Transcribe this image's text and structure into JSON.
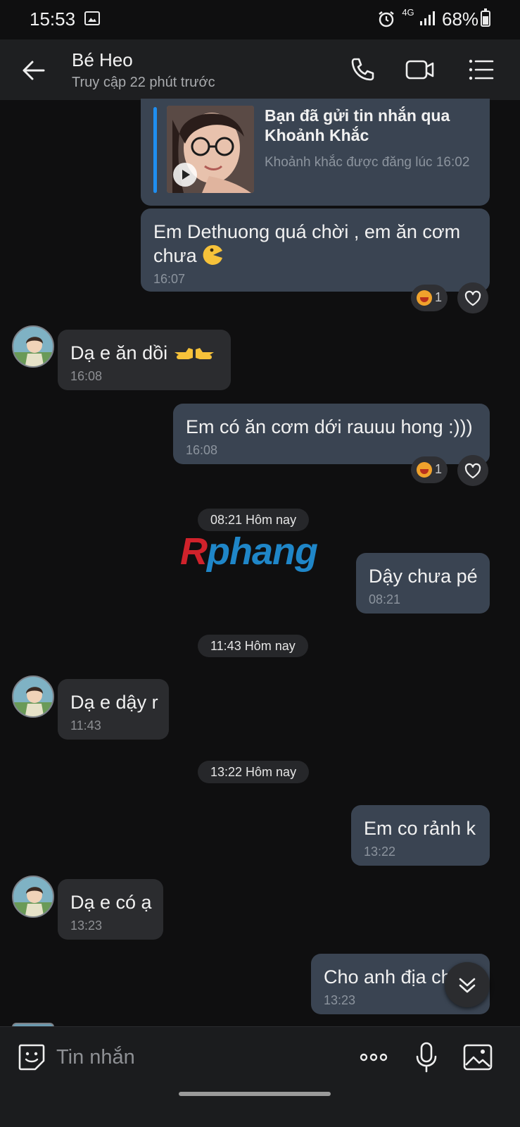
{
  "status_bar": {
    "time": "15:53",
    "network": "4G",
    "battery": "68%",
    "icons": [
      "gallery-icon",
      "alarm-icon",
      "signal-icon",
      "battery-icon"
    ]
  },
  "header": {
    "contact_name": "Bé Heo",
    "last_seen": "Truy cập 22 phút trước",
    "icons": [
      "back-arrow-icon",
      "phone-icon",
      "video-call-icon",
      "menu-list-icon"
    ]
  },
  "shared_card": {
    "title": "Bạn đã gửi tin nhắn qua Khoảnh Khắc",
    "subtitle": "Khoảnh khắc được đăng lúc 16:02"
  },
  "messages": [
    {
      "sender": "me",
      "text": "Em Dethuong quá chời , em ăn cơm chưa",
      "emoji_icon": "pacman-emoji-icon",
      "time": "16:07",
      "reaction_count": "1"
    },
    {
      "sender": "them",
      "text": "Dạ e ăn dồi",
      "emoji_icon": "pointing-hands-emoji-icon",
      "time": "16:08"
    },
    {
      "sender": "me",
      "text": "Em có ăn cơm dới rauuu hong :)))",
      "time": "16:08",
      "reaction_count": "1"
    },
    {
      "sender": "me",
      "text": "Dậy chưa pé",
      "time": "08:21"
    },
    {
      "sender": "them",
      "text": "Dạ e dậy r",
      "time": "11:43"
    },
    {
      "sender": "me",
      "text": "Em co rảnh k",
      "time": "13:22"
    },
    {
      "sender": "them",
      "text": "Dạ e có ạ",
      "time": "13:23"
    },
    {
      "sender": "me",
      "text": "Cho anh địa ch",
      "time": "13:23"
    }
  ],
  "date_separators": [
    "08:21 Hôm nay",
    "11:43 Hôm nay",
    "13:22 Hôm nay"
  ],
  "watermark": "Rphang",
  "composer": {
    "placeholder": "Tin nhắn",
    "icons": [
      "sticker-icon",
      "more-icon",
      "microphone-icon",
      "image-icon"
    ]
  },
  "colors": {
    "background": "#0f0f10",
    "my_bubble": "#3a4452",
    "their_bubble": "#2b2c2f",
    "accent": "#1f8ef0"
  }
}
